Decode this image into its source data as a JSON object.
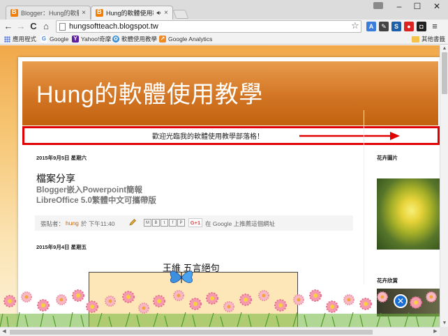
{
  "browser": {
    "tabs": [
      {
        "title": "Blogger：Hung的軟體使",
        "close": "×"
      },
      {
        "title": "Hung的軟體使用教學",
        "close": "×",
        "audio_icon": "speaker-icon"
      }
    ],
    "window_controls": {
      "minimize": "–",
      "maximize": "☐",
      "close": "✕"
    },
    "nav": {
      "back": "←",
      "forward": "→",
      "reload": "C",
      "home": "⌂"
    },
    "url": "hungsoftteach.blogspot.tw",
    "bookmarks": [
      {
        "label": "應用程式",
        "icon": "apps-grid-icon"
      },
      {
        "label": "Google",
        "icon": "google-icon"
      },
      {
        "label": "Yahoo!奇摩",
        "icon": "yahoo-icon"
      },
      {
        "label": "軟體使用教學",
        "icon": "blogger-icon"
      },
      {
        "label": "Google Analytics",
        "icon": "analytics-icon"
      }
    ],
    "other_bookmarks": "其他書籤",
    "colors": {
      "tab_favicon": "#f57d00",
      "highlight_box": "#e00000"
    }
  },
  "blog": {
    "title": "Hung的軟體使用教學",
    "description": "歡迎光臨我的軟體使用教學部落格！",
    "posts": [
      {
        "date": "2015年9月5日 星期六",
        "title": "檔案分享",
        "lines": [
          "Blogger嵌入Powerpoint簡報",
          "LibreOffice 5.0繁體中文可攜帶版"
        ],
        "footer": {
          "posted_by": "張貼者：",
          "author": "hung",
          "time": "於 下午11:40",
          "gplus": "G+1",
          "share_text": "在 Google 上推薦這個網址"
        }
      },
      {
        "date": "2015年9月4日 星期五",
        "title": "王維 五言絕句"
      }
    ],
    "sidebar": [
      {
        "heading": "花卉圖片"
      },
      {
        "heading": "花卉欣賞"
      }
    ]
  }
}
